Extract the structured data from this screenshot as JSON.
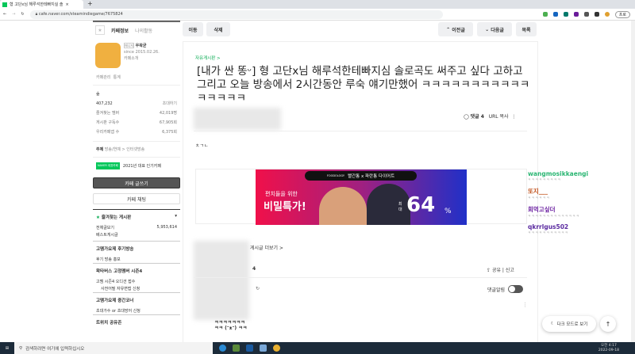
{
  "browser": {
    "tab_title": "형 고단x님 해루석한테빠지실 솔",
    "url": "cafe.naver.com/steamindiegame/7675824",
    "profile_label": "프로"
  },
  "sidebar": {
    "tab_info": "카페정보",
    "tab_activity": "나의활동",
    "manager_badge": "매니저",
    "manager_name": "우왁굳",
    "since": "since 2015.02.26.",
    "cafe_intro": "카페소개",
    "manage": "카페관리",
    "stats": "통계",
    "level": "숲",
    "members": "407,232",
    "invite": "초대하기",
    "stats_rows": [
      {
        "label": "즐겨찾는 멤버",
        "value": "42,019명"
      },
      {
        "label": "게시판 구독수",
        "value": "67,905회"
      },
      {
        "label": "우리카페앱 수",
        "value": "6,375회"
      }
    ],
    "topic_label": "주제",
    "topic": "방송/연예 > 인터넷방송",
    "award_badge": "NAVER 대표카페",
    "award": "2021년 대표 인기카페",
    "write_btn": "카페 글쓰기",
    "chat_btn": "카페 채팅",
    "fav_boards": "즐겨찾는 게시판",
    "all_posts": "전체글보기",
    "all_posts_count": "5,953,614",
    "best_posts": "베스트게시글",
    "sections": [
      {
        "title": "고멤가요제 후기방송",
        "items": [
          "후기 방송 홍보"
        ]
      },
      {
        "title": "왁타버스 고정멤버 시즌4",
        "items": [
          "고멤 시즌4 오디션 접수",
          "사전어필 자유면접 신청"
        ]
      },
      {
        "title": "고멤가요제 중간코너",
        "items": [
          "초대가수 or 초대망어 신청"
        ]
      },
      {
        "title": "트위치 공유존",
        "items": []
      }
    ]
  },
  "toolbar": {
    "move": "이동",
    "delete": "삭제",
    "prev": "이전글",
    "next": "다음글",
    "list": "목록"
  },
  "post": {
    "board": "자유게시판 >",
    "title": "[내가 싼 똥ᵕ] 형 고단x님 해루석한테빠지심 솔로곡도 써주고 싶다 고하고 그리고 오늘 방송에서 2시간동안 루숙 얘기만했어 ㅋㅋㅋㅋㅋㅋㅋㅋㅋㅋㅋㅋㅋㅋㅋㅋ",
    "comments_label": "댓글 4",
    "url_copy": "URL 복사",
    "body": "ㅊㄱㄴ",
    "more_posts": "게시글 더보기 >",
    "count": "4",
    "share": "공유",
    "report": "신고",
    "comment_alarm": "댓글알림"
  },
  "ad": {
    "brand": "FOODOLOGY",
    "headline": "빨간통 x 파란통 다이어트",
    "line1": "편치들을 위한",
    "line2": "비밀특가!",
    "max": "최대",
    "percent": "64",
    "unit": "%"
  },
  "chat": [
    {
      "name": "wangmosikkaengi",
      "msg": "ㅋㅋㅋㅋㅋㅋㅋㅋㅋ",
      "color": "#2bb673"
    },
    {
      "name": "또지___",
      "msg": "ㅋㅋㅋㅋㅋㅋ",
      "color": "#c0501a"
    },
    {
      "name": "회먹고싶더",
      "msg": "ㅋㅋㅋㅋㅋㅋㅋㅋㅋㅋㅋㅋㅋㅋ",
      "color": "#6a1fa0"
    },
    {
      "name": "qkrrlgus502",
      "msg": "ㅋㅋㅋㅋㅋㅋㅋㅋㅋㅋㅋ",
      "color": "#5a2aa0"
    }
  ],
  "floating": {
    "dark_mode": "다크 모드로 보기",
    "top": "↑"
  },
  "taskbar": {
    "search": "검색하려면 여기에 입력하십시오",
    "time": "오전 4:17",
    "date": "2022-09-18"
  }
}
